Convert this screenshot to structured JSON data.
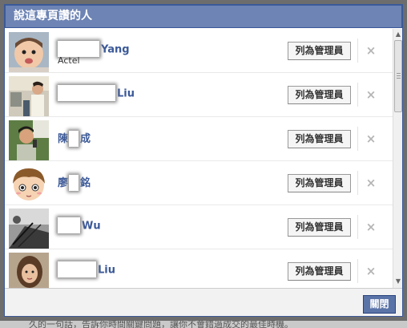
{
  "dialog": {
    "title": "說這專頁讚的人",
    "close_label": "關閉"
  },
  "people": [
    {
      "name_suffix": "Yang",
      "subtitle": "Actel",
      "admin_label": "列為管理員",
      "remove_icon": "×",
      "avatar": "baby"
    },
    {
      "name_suffix": "Liu",
      "subtitle": "",
      "admin_label": "列為管理員",
      "remove_icon": "×",
      "avatar": "office"
    },
    {
      "name_prefix": "陳",
      "name_suffix": "成",
      "subtitle": "",
      "admin_label": "列為管理員",
      "remove_icon": "×",
      "avatar": "man-phone"
    },
    {
      "name_prefix": "廖",
      "name_suffix": "銘",
      "subtitle": "",
      "admin_label": "列為管理員",
      "remove_icon": "×",
      "avatar": "cartoon-girl"
    },
    {
      "name_suffix": "Wu",
      "subtitle": "",
      "admin_label": "列為管理員",
      "remove_icon": "×",
      "avatar": "bw-city"
    },
    {
      "name_suffix": "Liu",
      "subtitle": "",
      "admin_label": "列為管理員",
      "remove_icon": "×",
      "avatar": "woman"
    }
  ],
  "background_text": "久的一句話，告訴你時間關鍵問題，讓你不會錯過成交的最佳時機。",
  "colors": {
    "title_bg": "#6d84b4",
    "link": "#3b5998",
    "close_button": "#5b74a8"
  }
}
